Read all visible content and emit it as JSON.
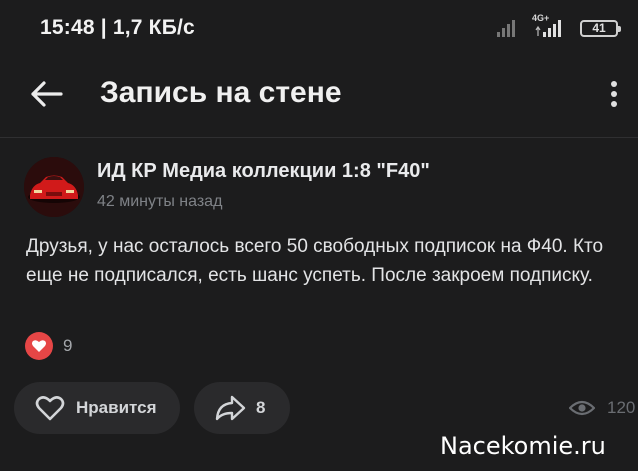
{
  "status_bar": {
    "text": "15:48 | 1,7 КБ/с",
    "network_label": "4G+",
    "battery": "41"
  },
  "header": {
    "title": "Запись на стене",
    "back_icon": "arrow-left-icon",
    "menu_icon": "more-vertical-icon"
  },
  "post": {
    "author": "ИД КР Медиа коллекции 1:8 \"F40\"",
    "time": "42 минуты назад",
    "text": "Друзья, у нас осталось всего 50 свободных подписок на Ф40. Кто еще не подписался, есть шанс успеть. После закроем подписку.",
    "reactions": {
      "icon": "heart-icon",
      "count": "9"
    },
    "actions": {
      "like_label": "Нравится",
      "share_count": "8"
    },
    "views": "120"
  },
  "watermark": "Nacekomie.ru",
  "colors": {
    "background": "#1c1c1d",
    "button_bg": "#2a2a2c",
    "reaction": "#e64646"
  }
}
